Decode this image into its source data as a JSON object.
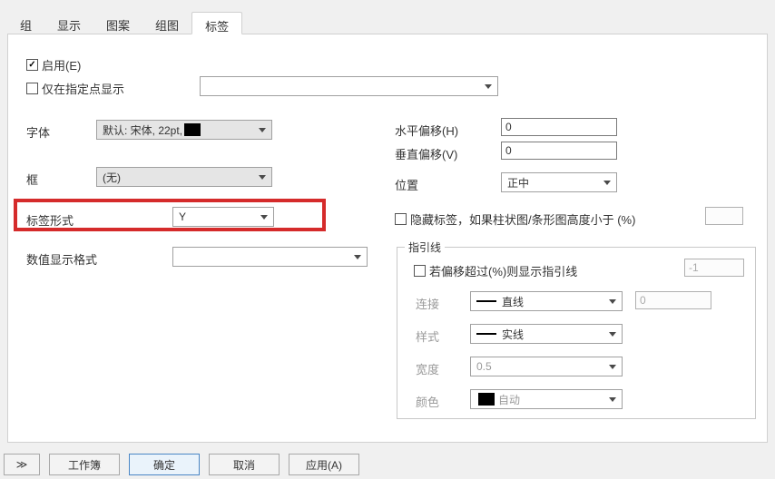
{
  "tabs": {
    "group": "组",
    "display": "显示",
    "pattern": "图案",
    "subplot": "组图",
    "labels": "标签"
  },
  "enable": {
    "label": "启用(E)",
    "checked": true
  },
  "show_only_at_points": {
    "label": "仅在指定点显示",
    "checked": false,
    "value": ""
  },
  "font": {
    "label": "字体",
    "value": "默认: 宋体, 22pt,",
    "swatch": "#000000"
  },
  "box": {
    "label": "框",
    "value": "(无)"
  },
  "label_form": {
    "label": "标签形式",
    "value": "Y"
  },
  "numeric_format": {
    "label": "数值显示格式",
    "value": ""
  },
  "h_offset": {
    "label": "水平偏移(H)",
    "value": "0"
  },
  "v_offset": {
    "label": "垂直偏移(V)",
    "value": "0"
  },
  "position": {
    "label": "位置",
    "value": "正中"
  },
  "hide_if": {
    "checked": false,
    "label": "隐藏标签，如果柱状图/条形图高度小于 (%)",
    "value": ""
  },
  "leader": {
    "title": "指引线",
    "enable": {
      "checked": false,
      "label": "若偏移超过(%)则显示指引线",
      "value": "-1"
    },
    "connect": {
      "label": "连接",
      "value": "直线",
      "extra": "0"
    },
    "style": {
      "label": "样式",
      "value": "实线"
    },
    "width": {
      "label": "宽度",
      "value": "0.5"
    },
    "color": {
      "label": "颜色",
      "value": "自动",
      "swatch": "#000000"
    }
  },
  "buttons": {
    "more": "≫",
    "workbook": "工作簿",
    "ok": "确定",
    "cancel": "取消",
    "apply": "应用(A)"
  }
}
